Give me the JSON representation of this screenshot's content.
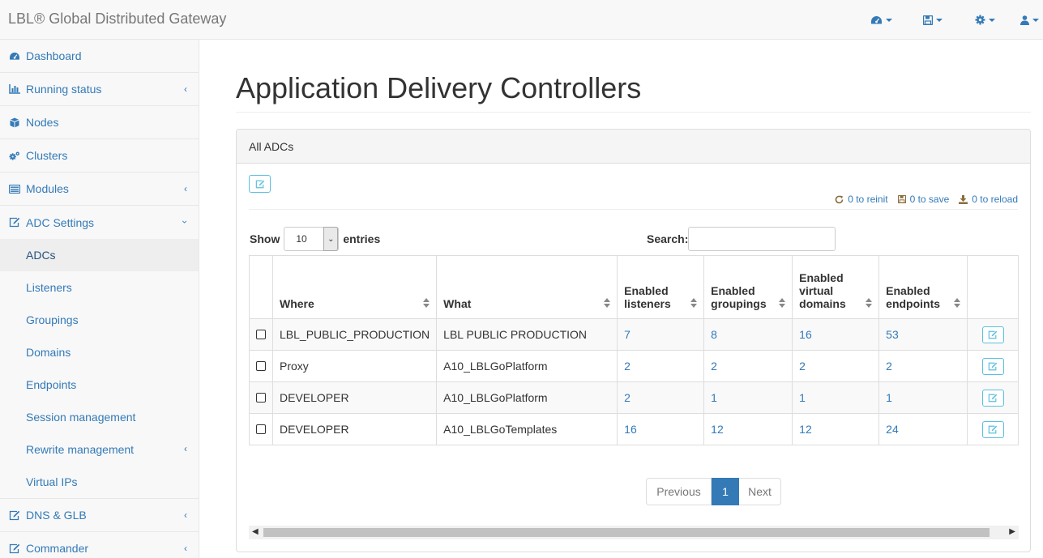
{
  "header": {
    "brand": "LBL® Global Distributed Gateway",
    "icons": [
      "dashboard-icon",
      "save-icon",
      "gear-icon",
      "user-icon"
    ]
  },
  "sidebar": {
    "items": [
      {
        "label": "Dashboard",
        "icon": "dashboard-icon"
      },
      {
        "label": "Running status",
        "icon": "bar-chart-icon"
      },
      {
        "label": "Nodes",
        "icon": "cube-icon"
      },
      {
        "label": "Clusters",
        "icon": "gears-icon"
      },
      {
        "label": "Modules",
        "icon": "list-icon"
      },
      {
        "label": "ADC Settings",
        "icon": "edit-icon"
      }
    ],
    "sub_items": [
      {
        "label": "ADCs"
      },
      {
        "label": "Listeners"
      },
      {
        "label": "Groupings"
      },
      {
        "label": "Domains"
      },
      {
        "label": "Endpoints"
      },
      {
        "label": "Session management"
      },
      {
        "label": "Rewrite management"
      },
      {
        "label": "Virtual IPs"
      }
    ],
    "bottom_items": [
      {
        "label": "DNS & GLB",
        "icon": "edit-icon"
      },
      {
        "label": "Commander",
        "icon": "edit-icon"
      }
    ]
  },
  "page": {
    "title": "Application Delivery Controllers",
    "panel_title": "All ADCs"
  },
  "status": {
    "reinit": "0 to reinit",
    "save": "0 to save",
    "reload": "0 to reload"
  },
  "table_controls": {
    "show_label": "Show",
    "entries_value": "10",
    "entries_label": "entries",
    "search_label": "Search:",
    "search_value": ""
  },
  "table": {
    "headers": {
      "where": "Where",
      "what": "What",
      "listeners_1": "Enabled",
      "listeners_2": "listeners",
      "groupings_1": "Enabled",
      "groupings_2": "groupings",
      "vdomains_1": "Enabled",
      "vdomains_2": "virtual",
      "vdomains_3": "domains",
      "endpoints_1": "Enabled",
      "endpoints_2": "endpoints"
    },
    "rows": [
      {
        "where": "LBL_PUBLIC_PRODUCTION",
        "what": "LBL PUBLIC PRODUCTION",
        "listeners": "7",
        "groupings": "8",
        "vdomains": "16",
        "endpoints": "53"
      },
      {
        "where": "Proxy",
        "what": "A10_LBLGoPlatform",
        "listeners": "2",
        "groupings": "2",
        "vdomains": "2",
        "endpoints": "2"
      },
      {
        "where": "DEVELOPER",
        "what": "A10_LBLGoPlatform",
        "listeners": "2",
        "groupings": "1",
        "vdomains": "1",
        "endpoints": "1"
      },
      {
        "where": "DEVELOPER",
        "what": "A10_LBLGoTemplates",
        "listeners": "16",
        "groupings": "12",
        "vdomains": "12",
        "endpoints": "24"
      }
    ]
  },
  "pagination": {
    "previous": "Previous",
    "current": "1",
    "next": "Next"
  }
}
